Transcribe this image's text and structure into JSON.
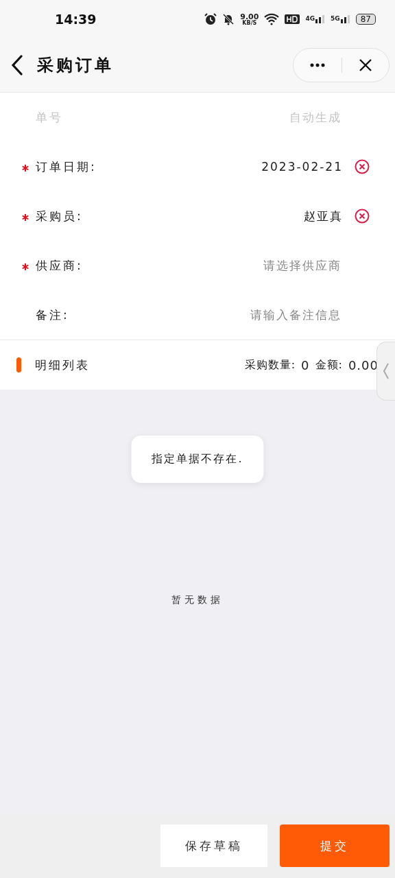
{
  "status_bar": {
    "time": "14:39",
    "speed": "9.00",
    "speed_unit": "KB/S",
    "network_1": "4G",
    "network_2": "5G",
    "battery": "87"
  },
  "header": {
    "title": "采购订单"
  },
  "form": [
    {
      "label": "单号",
      "placeholder": "自动生成",
      "required": false,
      "disabled": true,
      "clearable": false
    },
    {
      "label": "订单日期:",
      "value": "2023-02-21",
      "required": true,
      "disabled": false,
      "clearable": true
    },
    {
      "label": "采购员:",
      "value": "赵亚真",
      "required": true,
      "disabled": false,
      "clearable": true
    },
    {
      "label": "供应商:",
      "placeholder": "请选择供应商",
      "required": true,
      "disabled": false,
      "clearable": false
    },
    {
      "label": "备注:",
      "placeholder": "请输入备注信息",
      "required": false,
      "disabled": false,
      "clearable": false
    }
  ],
  "detail": {
    "title": "明细列表",
    "qty_label": "采购数量:",
    "qty": "0",
    "amount_label": "金额:",
    "amount": "0.00"
  },
  "toast": "指定单据不存在.",
  "empty_text": "暂无数据",
  "buttons": [
    {
      "label": "保存草稿",
      "kind": "secondary"
    },
    {
      "label": "提交",
      "kind": "primary"
    }
  ]
}
